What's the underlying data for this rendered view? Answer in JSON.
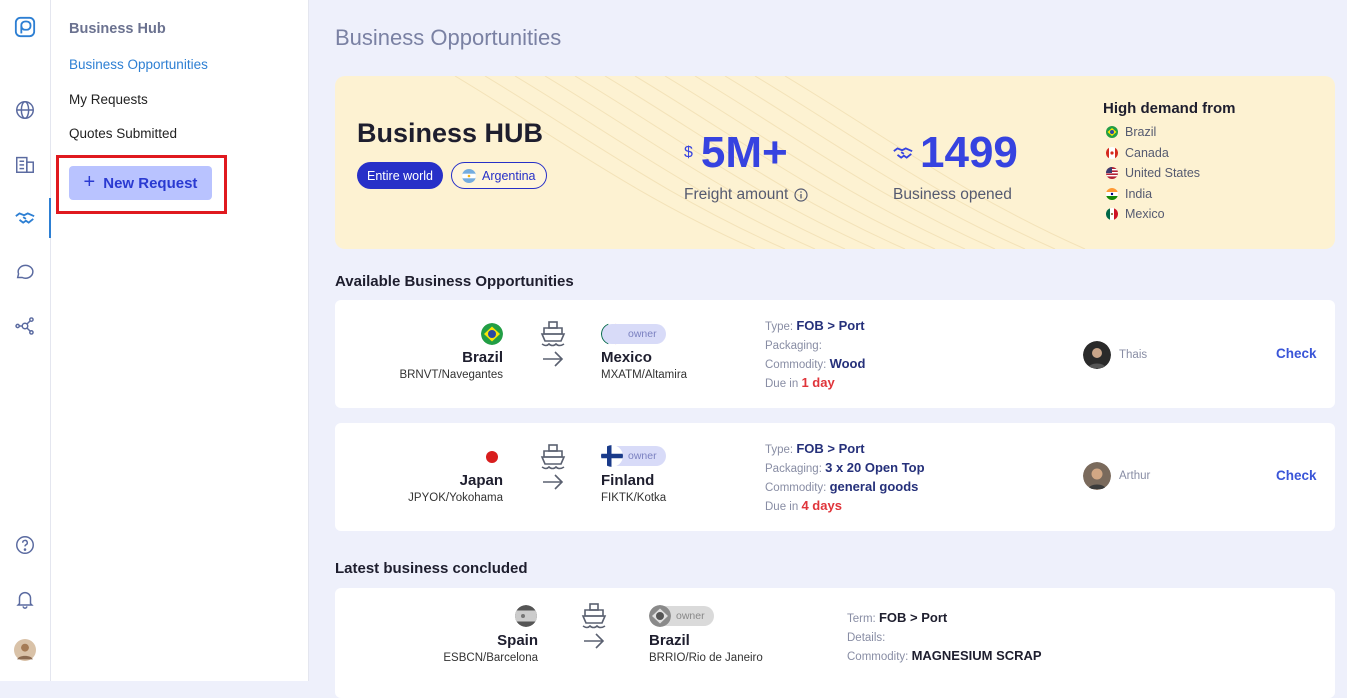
{
  "sidebar": {
    "icons": [
      "logo-icon",
      "globe-icon",
      "building-icon",
      "handshake-icon",
      "chat-icon",
      "network-icon",
      "help-icon",
      "bell-icon",
      "user-avatar"
    ]
  },
  "subnav": {
    "title": "Business Hub",
    "items": [
      "Business Opportunities",
      "My Requests",
      "Quotes Submitted"
    ],
    "new_request": "New Request"
  },
  "page_title": "Business Opportunities",
  "hero": {
    "title": "Business HUB",
    "pill_world": "Entire world",
    "pill_country": "Argentina",
    "freight_symbol": "$",
    "freight_value": "5M+",
    "freight_label": "Freight amount",
    "opened_value": "1499",
    "opened_label": "Business opened",
    "demand_title": "High demand from",
    "demand": [
      "Brazil",
      "Canada",
      "United States",
      "India",
      "Mexico"
    ]
  },
  "available": {
    "heading": "Available Business Opportunities",
    "cards": [
      {
        "origin": "Brazil",
        "origin_code": "BRNVT/Navegantes",
        "dest": "Mexico",
        "dest_code": "MXATM/Altamira",
        "owner": "owner",
        "type_label": "Type:",
        "type": "FOB > Port",
        "packaging_label": "Packaging:",
        "packaging": "",
        "commodity_label": "Commodity:",
        "commodity": "Wood",
        "due_label": "Due in",
        "due": "1 day",
        "user": "Thais",
        "action": "Check"
      },
      {
        "origin": "Japan",
        "origin_code": "JPYOK/Yokohama",
        "dest": "Finland",
        "dest_code": "FIKTK/Kotka",
        "owner": "owner",
        "type_label": "Type:",
        "type": "FOB > Port",
        "packaging_label": "Packaging:",
        "packaging": "3 x 20 Open Top",
        "commodity_label": "Commodity:",
        "commodity": "general goods",
        "due_label": "Due in",
        "due": "4 days",
        "user": "Arthur",
        "action": "Check"
      }
    ]
  },
  "concluded": {
    "heading": "Latest business concluded",
    "cards": [
      {
        "origin": "Spain",
        "origin_code": "ESBCN/Barcelona",
        "dest": "Brazil",
        "dest_code": "BRRIO/Rio de Janeiro",
        "owner": "owner",
        "term_label": "Term:",
        "term": "FOB > Port",
        "details_label": "Details:",
        "details": "",
        "commodity_label": "Commodity:",
        "commodity": "MAGNESIUM SCRAP"
      }
    ]
  },
  "colors": {
    "accent": "#3643e0",
    "hero_bg": "#fdf2d2",
    "page_bg": "#eef0fb",
    "highlight": "#e0191f"
  }
}
